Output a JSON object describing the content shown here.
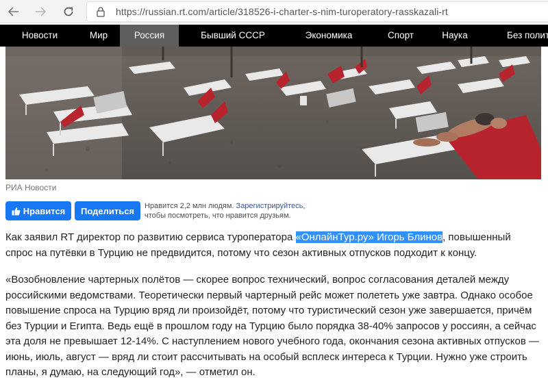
{
  "browser": {
    "url": "https://russian.rt.com/article/318526-i-charter-s-nim-turoperatory-rasskazali-rt"
  },
  "site_nav": {
    "items": [
      {
        "label": "Новости",
        "active": false
      },
      {
        "label": "Мир",
        "active": false
      },
      {
        "label": "Россия",
        "active": true
      },
      {
        "label": "Бывший СССР",
        "active": false
      },
      {
        "label": "Экономика",
        "active": false
      },
      {
        "label": "Спорт",
        "active": false
      },
      {
        "label": "Наука",
        "active": false
      },
      {
        "label": "Без полити",
        "active": false
      }
    ]
  },
  "photo": {
    "caption": "РИА Новости"
  },
  "social": {
    "like_label": "Нравится",
    "share_label": "Поделиться",
    "likes_text": "Нравится 2,2 млн людям.",
    "register_link": "Зарегистрируйтесь,",
    "likes_text_2": "чтобы посмотреть, что нравится друзьям."
  },
  "article": {
    "p1_before": "Как заявил RT директор по развитию сервиса туроператора ",
    "p1_highlight": "«ОнлайнТур.ру» Игорь Блинов",
    "p1_after": ", повышенный спрос на путёвки в Турцию не предвидится, потому что сезон активных отпусков подходит к концу.",
    "p2": "«Возобновление чартерных полётов — скорее вопрос технический, вопрос согласования деталей между российскими ведомствами. Теоретически первый чартерный рейс может полететь уже завтра. Однако особое повышение спроса на Турцию вряд ли произойдёт, потому что туристический сезон уже завершается, причём без Турции и Египта. Ведь ещё в прошлом году на Турцию было порядка 38-40% запросов у россиян, а сейчас эта доля не превышает 12-14%. С наступлением нового учебного года, окончания сезона активных отпусков — июнь, июль, август — вряд ли стоит рассчитывать на особый всплеск интереса к Турции. Нужно уже строить планы, я думаю, на следующий год», — отметил он."
  },
  "colors": {
    "nav_bg": "#000000",
    "nav_active": "#5e5e5e",
    "facebook_blue": "#1877f2",
    "selection": "#3390ff"
  }
}
